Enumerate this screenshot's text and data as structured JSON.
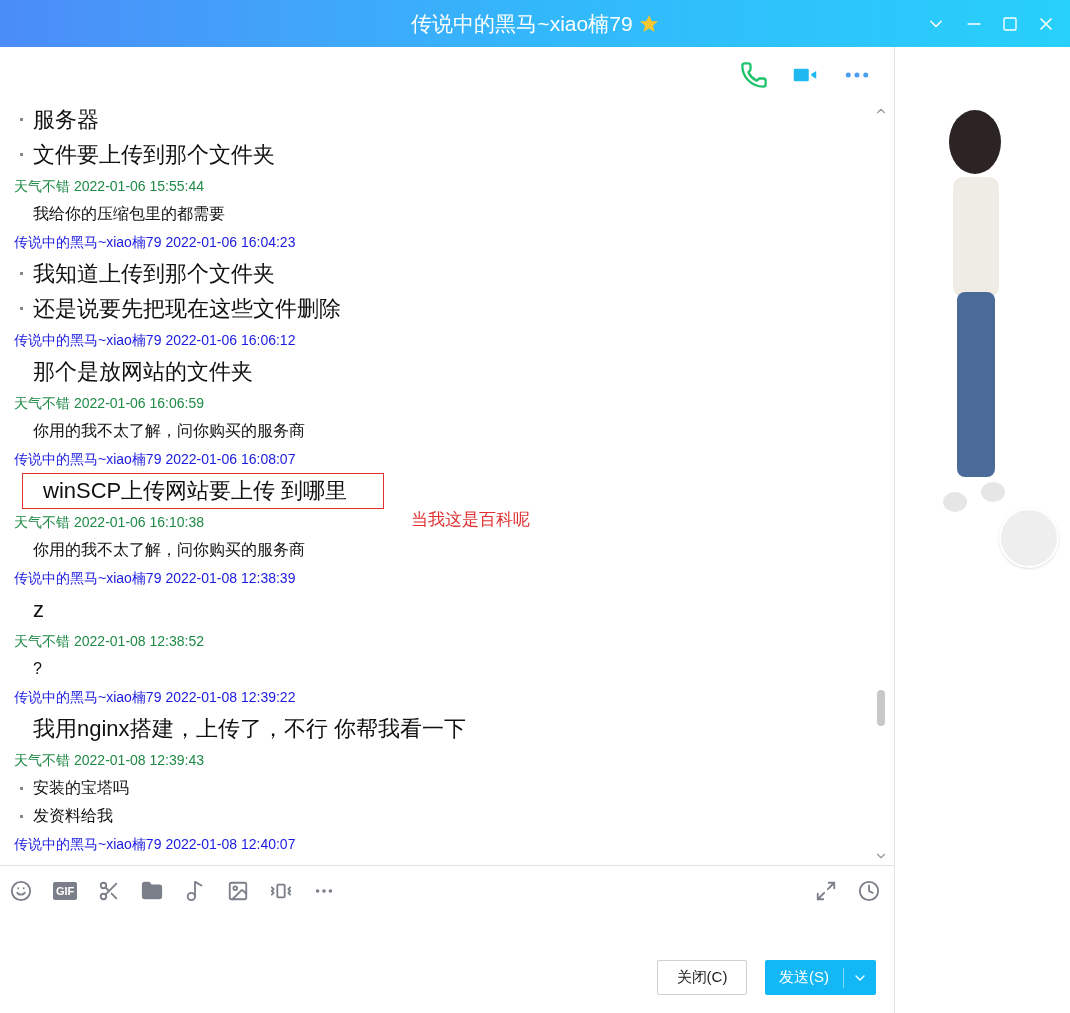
{
  "window": {
    "title": "传说中的黑马~xiao楠79"
  },
  "messages": [
    {
      "kind": "text",
      "text": "服务器",
      "bullet": true,
      "large": true
    },
    {
      "kind": "text",
      "text": "文件要上传到那个文件夹",
      "bullet": true,
      "large": true
    },
    {
      "kind": "header",
      "sender": "天气不错",
      "time": "2022-01-06 15:55:44",
      "color": "#1e8a45"
    },
    {
      "kind": "text",
      "text": "我给你的压缩包里的都需要",
      "bullet": false,
      "large": false
    },
    {
      "kind": "header",
      "sender": "传说中的黑马~xiao楠79",
      "time": "2022-01-06 16:04:23",
      "color": "#1a1ae0"
    },
    {
      "kind": "text",
      "text": "我知道上传到那个文件夹",
      "bullet": true,
      "large": true
    },
    {
      "kind": "text",
      "text": "还是说要先把现在这些文件删除",
      "bullet": true,
      "large": true
    },
    {
      "kind": "header",
      "sender": "传说中的黑马~xiao楠79",
      "time": "2022-01-06 16:06:12",
      "color": "#1a1ae0"
    },
    {
      "kind": "text",
      "text": "那个是放网站的文件夹",
      "bullet": false,
      "large": true
    },
    {
      "kind": "header",
      "sender": "天气不错",
      "time": "2022-01-06 16:06:59",
      "color": "#1e8a45"
    },
    {
      "kind": "text",
      "text": "你用的我不太了解，问你购买的服务商",
      "bullet": false,
      "large": false
    },
    {
      "kind": "header",
      "sender": "传说中的黑马~xiao楠79",
      "time": "2022-01-06 16:08:07",
      "color": "#1a1ae0"
    },
    {
      "kind": "text",
      "text": "winSCP上传网站要上传 到哪里",
      "bullet": false,
      "large": true,
      "highlighted": true,
      "annotation": "当我这是百科呢"
    },
    {
      "kind": "header",
      "sender": "天气不错",
      "time": "2022-01-06 16:10:38",
      "color": "#1e8a45"
    },
    {
      "kind": "text",
      "text": "你用的我不太了解，问你购买的服务商",
      "bullet": false,
      "large": false
    },
    {
      "kind": "header",
      "sender": "传说中的黑马~xiao楠79",
      "time": "2022-01-08 12:38:39",
      "color": "#1a1ae0"
    },
    {
      "kind": "text",
      "text": "z",
      "bullet": false,
      "large": true
    },
    {
      "kind": "header",
      "sender": "天气不错",
      "time": "2022-01-08 12:38:52",
      "color": "#1e8a45"
    },
    {
      "kind": "text",
      "text": "?",
      "bullet": false,
      "large": false
    },
    {
      "kind": "header",
      "sender": "传说中的黑马~xiao楠79",
      "time": "2022-01-08 12:39:22",
      "color": "#1a1ae0"
    },
    {
      "kind": "text",
      "text": "我用nginx搭建，上传了，不行 你帮我看一下",
      "bullet": false,
      "large": true
    },
    {
      "kind": "header",
      "sender": "天气不错",
      "time": "2022-01-08 12:39:43",
      "color": "#1e8a45"
    },
    {
      "kind": "text",
      "text": "安装的宝塔吗",
      "bullet": true,
      "large": false
    },
    {
      "kind": "text",
      "text": "发资料给我",
      "bullet": true,
      "large": false
    },
    {
      "kind": "header",
      "sender": "传说中的黑马~xiao楠79",
      "time": "2022-01-08 12:40:07",
      "color": "#1a1ae0"
    }
  ],
  "toolbar": {
    "gif_label": "GIF"
  },
  "buttons": {
    "close": "关闭(C)",
    "send": "发送(S)"
  }
}
